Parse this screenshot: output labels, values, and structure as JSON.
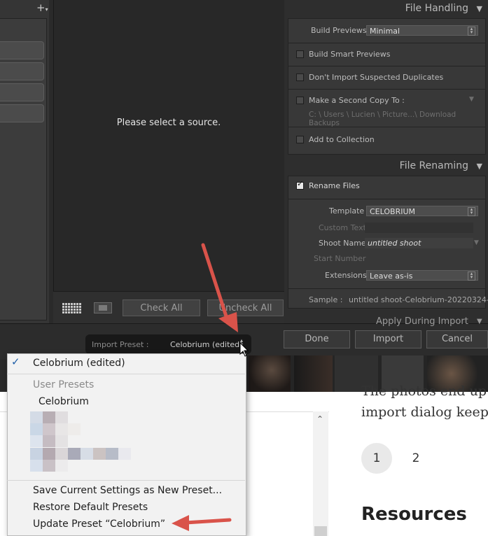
{
  "lightroom": {
    "center_message": "Please select a source.",
    "center_buttons": {
      "check_all": "Check All",
      "uncheck_all": "Uncheck All"
    },
    "file_handling": {
      "title": "File Handling",
      "build_previews_label": "Build Previews",
      "build_previews_value": "Minimal",
      "build_smart_previews": "Build Smart Previews",
      "dont_import_duplicates": "Don't Import Suspected Duplicates",
      "second_copy_label": "Make a Second Copy To :",
      "second_copy_path": "C: \\ Users \\ Lucien \\ Picture...\\ Download Backups",
      "add_to_collection": "Add to Collection"
    },
    "file_renaming": {
      "title": "File Renaming",
      "rename_files": "Rename Files",
      "rename_checked": true,
      "template_label": "Template",
      "template_value": "CELOBRIUM",
      "custom_text_label": "Custom Text",
      "shoot_name_label": "Shoot Name",
      "shoot_name_value": "untitled shoot",
      "start_number_label": "Start Number",
      "extensions_label": "Extensions",
      "extensions_value": "Leave as-is",
      "sample_label": "Sample :",
      "sample_value": "untitled shoot-Celobrium-20220324-..."
    },
    "apply_during_import": "Apply During Import",
    "import_preset_label": "Import Preset :",
    "import_preset_value": "Celobrium (edited)",
    "actions": {
      "done": "Done",
      "import": "Import",
      "cancel": "Cancel"
    }
  },
  "preset_menu": {
    "selected_item": "Celobrium (edited)",
    "user_presets_header": "User Presets",
    "user_presets": [
      "Celobrium"
    ],
    "save_current": "Save Current Settings as New Preset...",
    "restore_defaults": "Restore Default Presets",
    "update_preset": "Update Preset “Celobrium”"
  },
  "webpage": {
    "paragraph_line1": "The photos end up i",
    "paragraph_line2": "import dialog keeps",
    "pagination": [
      "1",
      "2"
    ],
    "heading": "Resources"
  },
  "colors": {
    "annotation_arrow": "#d9534a",
    "dialog_bg": "#2a2a2a",
    "menu_bg": "#f2f2f2",
    "checkmark": "#1f5fa8"
  },
  "icons": [
    "plus-icon",
    "grid-view-icon",
    "loupe-view-icon",
    "checkmark-icon",
    "mouse-cursor-icon",
    "chevron-up-icon"
  ]
}
